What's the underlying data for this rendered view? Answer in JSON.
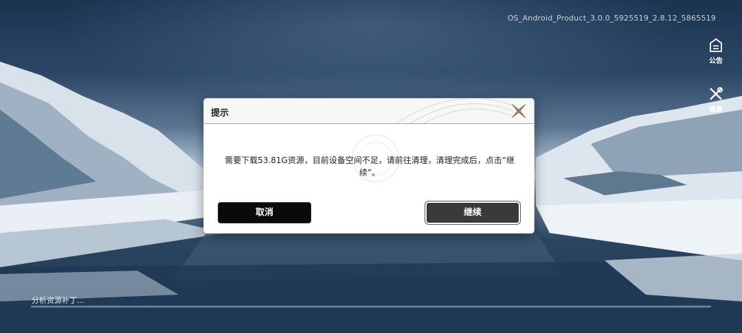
{
  "version_text": "OS_Android_Product_3.0.0_5925519_2.8.12_5865519",
  "side": {
    "notice_label": "公告",
    "repair_label": "修复"
  },
  "dialog": {
    "title": "提示",
    "message": "需要下载53.81G资源，目前设备空间不足，请前往清理，清理完成后，点击“继续”。",
    "cancel_label": "取消",
    "continue_label": "继续"
  },
  "status_text": "分析资源补丁...",
  "progress_value": 0,
  "colors": {
    "dialog_bg": "#ffffff",
    "button_dark": "#0a0a0a",
    "button_gray": "#3a3a3a",
    "accent_gold": "#9a8358"
  }
}
